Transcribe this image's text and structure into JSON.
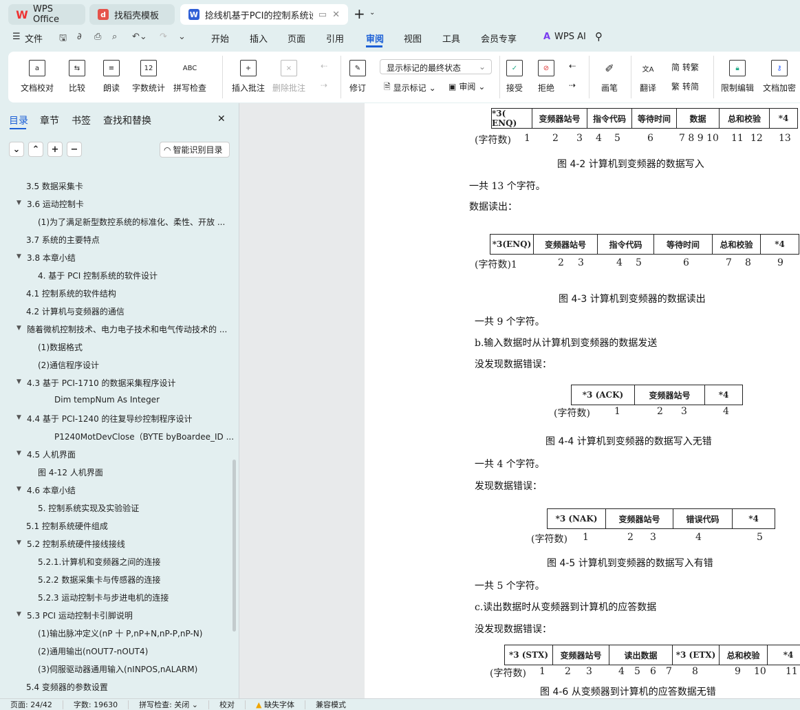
{
  "tabs": [
    {
      "label": "WPS Office"
    },
    {
      "label": "找稻壳模板"
    },
    {
      "label": "捻线机基于PCI的控制系统设计"
    }
  ],
  "menu": {
    "file": "文件",
    "items": [
      "开始",
      "插入",
      "页面",
      "引用",
      "审阅",
      "视图",
      "工具",
      "会员专享"
    ],
    "active": "审阅",
    "ai": "WPS AI"
  },
  "ribbon": {
    "proof": "文档校对",
    "compare": "比较",
    "read": "朗读",
    "wordcount": "字数统计",
    "spell": "拼写检查",
    "insert_comment": "插入批注",
    "delete_comment": "删除批注",
    "revise": "修订",
    "markup_state": "显示标记的最终状态",
    "show_markup": "显示标记",
    "review": "审阅",
    "accept": "接受",
    "reject": "拒绝",
    "pen": "画笔",
    "translate": "翻译",
    "to_trad": "转繁",
    "to_simp": "转简",
    "restrict": "限制编辑",
    "encrypt": "文档加密"
  },
  "sidebar": {
    "tabs": [
      "目录",
      "章节",
      "书签",
      "查找和替换"
    ],
    "smart_toc": "智能识别目录",
    "items": [
      {
        "label": "3.5  数据采集卡",
        "level": 1,
        "arrow": false
      },
      {
        "label": "3.6  运动控制卡",
        "level": 1,
        "arrow": true
      },
      {
        "label": "(1)为了满足新型数控系统的标准化、柔性、开放 ...",
        "level": 2,
        "arrow": false
      },
      {
        "label": "3.7  系统的主要特点",
        "level": 1,
        "arrow": false
      },
      {
        "label": "3.8  本章小结",
        "level": 1,
        "arrow": true
      },
      {
        "label": "4.  基于 PCI 控制系统的软件设计",
        "level": 2,
        "arrow": false
      },
      {
        "label": "4.1  控制系统的软件结构",
        "level": 1,
        "arrow": false
      },
      {
        "label": "4.2  计算机与变频器的通信",
        "level": 1,
        "arrow": false
      },
      {
        "label": "随着微机控制技术、电力电子技术和电气传动技术的 ...",
        "level": 1,
        "arrow": true
      },
      {
        "label": "(1)数据格式",
        "level": 2,
        "arrow": false
      },
      {
        "label": "(2)通信程序设计",
        "level": 2,
        "arrow": false
      },
      {
        "label": "4.3  基于 PCI-1710 的数据采集程序设计",
        "level": 1,
        "arrow": true
      },
      {
        "label": "Dim tempNum As Integer",
        "level": 3,
        "arrow": false
      },
      {
        "label": "4.4  基于 PCI-1240 的往复导纱控制程序设计",
        "level": 1,
        "arrow": true
      },
      {
        "label": "P1240MotDevClose（BYTE byBoardee_ID ...",
        "level": 3,
        "arrow": false
      },
      {
        "label": "4.5  人机界面",
        "level": 1,
        "arrow": true
      },
      {
        "label": "图 4-12  人机界面",
        "level": 2,
        "arrow": false
      },
      {
        "label": "4.6  本章小结",
        "level": 1,
        "arrow": true
      },
      {
        "label": "5.  控制系统实现及实验验证",
        "level": 2,
        "arrow": false
      },
      {
        "label": "5.1  控制系统硬件组成",
        "level": 1,
        "arrow": false
      },
      {
        "label": "5.2  控制系统硬件接线接线",
        "level": 1,
        "arrow": true
      },
      {
        "label": "5.2.1.计算机和变频器之间的连接",
        "level": 2,
        "arrow": false
      },
      {
        "label": "5.2.2  数据采集卡与传感器的连接",
        "level": 2,
        "arrow": false
      },
      {
        "label": "5.2.3  运动控制卡与步进电机的连接",
        "level": 2,
        "arrow": false
      },
      {
        "label": "5.3 PCI 运动控制卡引脚说明",
        "level": 1,
        "arrow": true
      },
      {
        "label": "(1)输出脉冲定义(nP 十 P,nP+N,nP-P,nP-N)",
        "level": 2,
        "arrow": false
      },
      {
        "label": "(2)通用输出(nOUT7-nOUT4)",
        "level": 2,
        "arrow": false
      },
      {
        "label": "(3)伺服驱动器通用输入(nINPOS,nALARM)",
        "level": 2,
        "arrow": false
      },
      {
        "label": "5.4  变频器的参数设置",
        "level": 1,
        "arrow": false
      }
    ]
  },
  "document": {
    "paragraphs": [
      "一共 13 个字符。",
      "数据读出：",
      "一共 9 个字符。",
      "b.输入数据时从计算机到变频器的数据发送",
      "没发现数据错误：",
      "一共 4 个字符。",
      "发现数据错误：",
      "一共 5 个字符。",
      "c.读出数据时从变频器到计算机的应答数据",
      "没发现数据错误："
    ],
    "figures": [
      {
        "caption": "图 4-2 计算机到变频器的数据写入",
        "cells": [
          "*3( ENQ)",
          "变频器站号",
          "指令代码",
          "等待时间",
          "数据",
          "总和校验",
          "*4"
        ],
        "counts": [
          "(字符数)",
          "1",
          "2",
          "3",
          "4",
          "5",
          "6",
          "7 8 9 10",
          "11",
          "12",
          "13"
        ]
      },
      {
        "caption": "图 4-3 计算机到变频器的数据读出",
        "cells": [
          "*3(ENQ)",
          "变频器站号",
          "指令代码",
          "等待时间",
          "总和校验",
          "*4"
        ],
        "counts": [
          "(字符数)1",
          "2",
          "3",
          "4",
          "5",
          "6",
          "7",
          "8",
          "9"
        ]
      },
      {
        "caption": "图 4-4 计算机到变频器的数据写入无错",
        "cells": [
          "*3  (ACK)",
          "变频器站号",
          "*4"
        ],
        "counts": [
          "(字符数)",
          "1",
          "2",
          "3",
          "4"
        ]
      },
      {
        "caption": "图 4-5 计算机到变频器的数据写入有错",
        "cells": [
          "*3  (NAK)",
          "变频器站号",
          "错误代码",
          "*4"
        ],
        "counts": [
          "(字符数)",
          "1",
          "2",
          "3",
          "4",
          "5"
        ]
      },
      {
        "caption": "图 4-6 从变频器到计算机的应答数据无错",
        "cells": [
          "*3 (STX)",
          "变频器站号",
          "读出数据",
          "*3 (ETX)",
          "总和校验",
          "*4"
        ],
        "counts": [
          "(字符数)",
          "1",
          "2",
          "3",
          "4",
          "5",
          "6",
          "7",
          "8",
          "9",
          "10",
          "11"
        ]
      }
    ]
  },
  "status": {
    "page": "页面: 24/42",
    "words": "字数: 19630",
    "spell": "拼写检查: 关闭",
    "proof": "校对",
    "missing_font": "缺失字体",
    "compat": "兼容模式"
  }
}
